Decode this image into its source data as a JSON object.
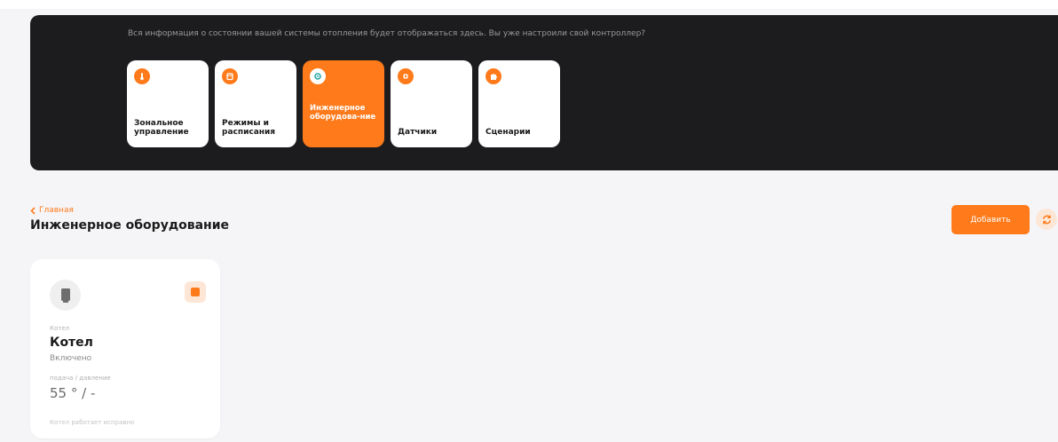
{
  "banner": {
    "text": "Вся информация о состоянии вашей системы отопления будет отображаться здесь. Вы уже настроили свой контроллер?",
    "tiles": [
      {
        "label": "Зональное управление",
        "icon": "thermometer-icon",
        "active": false
      },
      {
        "label": "Режимы и расписания",
        "icon": "calendar-icon",
        "active": false
      },
      {
        "label": "Инженерное оборудова-ние",
        "icon": "gear-icon",
        "active": true
      },
      {
        "label": "Датчики",
        "icon": "sensor-icon",
        "active": false
      },
      {
        "label": "Сценарии",
        "icon": "puzzle-icon",
        "active": false
      }
    ]
  },
  "breadcrumb": {
    "label": "Главная"
  },
  "page": {
    "title": "Инженерное оборудование"
  },
  "actions": {
    "add_label": "Добавить",
    "refresh_icon": "refresh-icon"
  },
  "device": {
    "type": "Котел",
    "name": "Котел",
    "status": "Включено",
    "metric_label": "подача / давление",
    "metric_value": "55 ° / -",
    "note": "Котел работает исправно",
    "icon": "boiler-icon"
  },
  "colors": {
    "accent": "#ff7a1a",
    "banner_bg": "#1c1c1e",
    "page_bg": "#f5f5f7"
  }
}
